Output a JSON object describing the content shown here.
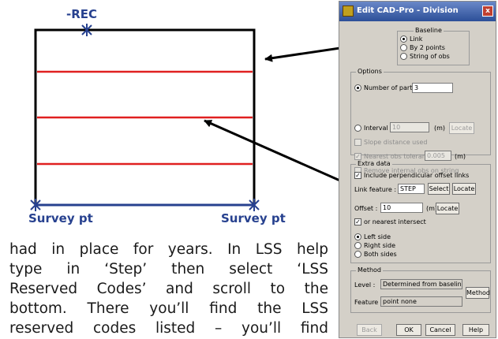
{
  "figure": {
    "top_label": "-REC",
    "bottom_left_label": "Survey pt",
    "bottom_right_label": "Survey pt"
  },
  "paragraph": {
    "lines": [
      "had in place for years. In LSS help",
      "type in ‘Step’ then select ‘LSS",
      "Reserved Codes’ and scroll to the",
      "bottom. There you’ll find the LSS",
      "reserved codes listed – you’ll find"
    ]
  },
  "dialog": {
    "title": "Edit CAD-Pro - Division",
    "close_glyph": "x",
    "baseline": {
      "title": "Baseline",
      "options": [
        "Link",
        "By 2 points",
        "String of obs"
      ],
      "selected": "Link"
    },
    "options": {
      "title": "Options",
      "number_of_parts_label": "Number of parts :",
      "number_of_parts_value": "3",
      "interval_label": "Interval :",
      "interval_value": "10",
      "interval_unit": "(m)",
      "interval_locate": "Locate",
      "slope_distance": "Slope distance used",
      "nearest_obs_label": "Nearest obs tolerance :",
      "nearest_obs_value": "0.005",
      "nearest_obs_unit": "(m)",
      "remove_internal": "Remove internal obs on string",
      "check_glyph": "✓"
    },
    "extra_data": {
      "title": "Extra data",
      "include_offset": "Include perpendicular offset links",
      "link_feature_label": "Link feature :",
      "link_feature_value": "STEP",
      "select_button": "Select",
      "locate_button": "Locate",
      "offset_label": "Offset :",
      "offset_value": "10",
      "offset_unit": "(m)",
      "offset_locate": "Locate",
      "nearest_intersect": "or nearest intersect",
      "sides": [
        "Left side",
        "Right side",
        "Both sides"
      ],
      "selected_side": "Left side"
    },
    "method": {
      "title": "Method",
      "level_label": "Level :",
      "level_value": "Determined from baseline",
      "feature_label": "Feature :",
      "feature_value": "point none",
      "method_button": "Method"
    },
    "buttons": {
      "back": "Back",
      "ok": "OK",
      "cancel": "Cancel",
      "help": "Help"
    }
  },
  "colors": {
    "division_line": "#e02020",
    "label_blue": "#27418f",
    "arrow": "#000000"
  }
}
